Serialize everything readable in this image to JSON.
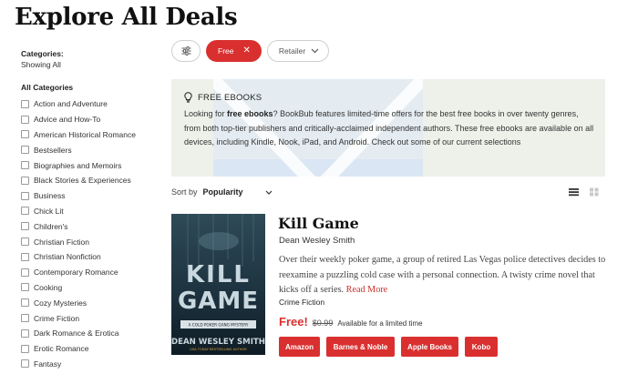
{
  "page": {
    "title": "Explore All Deals"
  },
  "sidebar": {
    "categories_heading": "Categories:",
    "showing": "Showing All",
    "all_heading": "All Categories",
    "items": [
      {
        "label": "Action and Adventure"
      },
      {
        "label": "Advice and How-To"
      },
      {
        "label": "American Historical Romance"
      },
      {
        "label": "Bestsellers"
      },
      {
        "label": "Biographies and Memoirs"
      },
      {
        "label": "Black Stories & Experiences"
      },
      {
        "label": "Business"
      },
      {
        "label": "Chick Lit"
      },
      {
        "label": "Children's"
      },
      {
        "label": "Christian Fiction"
      },
      {
        "label": "Christian Nonfiction"
      },
      {
        "label": "Contemporary Romance"
      },
      {
        "label": "Cooking"
      },
      {
        "label": "Cozy Mysteries"
      },
      {
        "label": "Crime Fiction"
      },
      {
        "label": "Dark Romance & Erotica"
      },
      {
        "label": "Erotic Romance"
      },
      {
        "label": "Fantasy"
      }
    ]
  },
  "filters": {
    "settings_icon": "sliders-icon",
    "free_label": "Free",
    "free_remove_icon": "close-icon",
    "retailer_label": "Retailer",
    "retailer_icon": "chevron-down-icon"
  },
  "banner": {
    "icon": "lightbulb-icon",
    "title": "FREE EBOOKS",
    "text_pre": "Looking for ",
    "text_bold": "free ebooks",
    "text_post": "? BookBub features limited-time offers for the best free books in over twenty genres, from both top-tier publishers and critically-acclaimed independent authors. These free ebooks are available on all devices, including Kindle, Nook, iPad, and Android. Check out some of our current selections"
  },
  "sort": {
    "label": "Sort by",
    "value": "Popularity",
    "icon": "chevron-down-icon"
  },
  "view": {
    "list_icon": "list-view-icon",
    "grid_icon": "grid-view-icon"
  },
  "book": {
    "title": "Kill Game",
    "author": "Dean Wesley Smith",
    "description": "Over their weekly poker game, a group of retired Las Vegas police detectives decides to reexamine a puzzling cold case with a personal connection. A twisty crime novel that kicks off a series.",
    "read_more": "Read More",
    "genre": "Crime Fiction",
    "price_free": "Free!",
    "price_old": "$0.99",
    "price_note": "Available for a limited time",
    "cover": {
      "title_line1": "KILL",
      "title_line2": "GAME",
      "series": "A COLD POKER GANG MYSTERY",
      "author": "DEAN WESLEY SMITH",
      "tagline": "USA TODAY BESTSELLING AUTHOR"
    },
    "retailers": [
      {
        "label": "Amazon"
      },
      {
        "label": "Barnes & Noble"
      },
      {
        "label": "Apple Books"
      },
      {
        "label": "Kobo"
      }
    ]
  },
  "colors": {
    "accent": "#d9302f",
    "banner_bg": "#eef1ea",
    "cover_bg": "#1c2c36"
  }
}
